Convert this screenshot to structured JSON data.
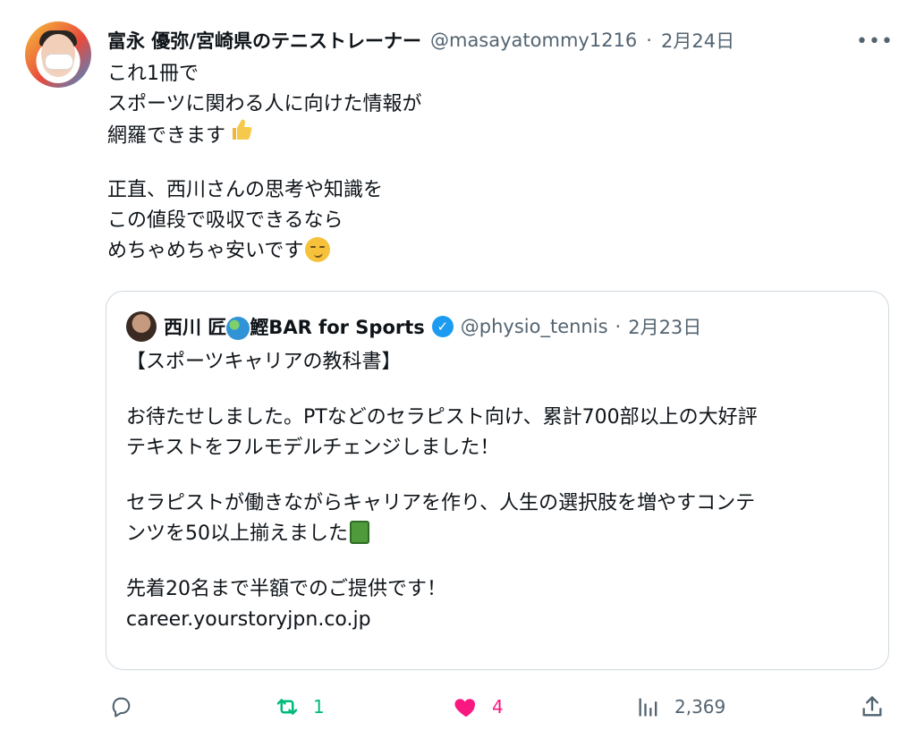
{
  "author": {
    "display_name": "富永 優弥/宮崎県のテニストレーナー",
    "handle": "@masayatommy1216",
    "separator": "·",
    "date": "2月24日"
  },
  "more_icon": "more-horizontal-icon",
  "tweet_lines": [
    "これ1冊で",
    "スポーツに関わる人に向けた情報が",
    "網羅できます",
    "",
    "正直、西川さんの思考や知識を",
    "この値段で吸収できるなら",
    "めちゃめちゃ安いです"
  ],
  "emojis": {
    "line3": "thumbs-up-icon",
    "line7": "smirking-face-icon",
    "quote_line7": "green-book-icon",
    "quote_name": "globe-icon"
  },
  "quote": {
    "name_part1": "西川 匠",
    "name_part2": "鰹BAR for Sports",
    "verified_icon": "verified-badge-icon",
    "handle": "@physio_tennis",
    "separator": "·",
    "date": "2月23日",
    "lines": [
      "【スポーツキャリアの教科書】",
      "",
      "お待たせしました。PTなどのセラピスト向け、累計700部以上の大好評",
      "テキストをフルモデルチェンジしました！",
      "",
      "セラピストが働きながらキャリアを作り、人生の選択肢を増やすコンテ",
      "ンツを50以上揃えました",
      "",
      "先着20名まで半額でのご提供です！",
      "career.yourstoryjpn.co.jp"
    ]
  },
  "actions": {
    "reply": {
      "icon": "reply-icon",
      "count": ""
    },
    "retweet": {
      "icon": "retweet-icon",
      "count": "1",
      "color": "#00ba7c"
    },
    "like": {
      "icon": "heart-icon",
      "count": "4",
      "color": "#f91880"
    },
    "views": {
      "icon": "views-icon",
      "count": "2,369"
    },
    "share": {
      "icon": "share-icon"
    }
  }
}
